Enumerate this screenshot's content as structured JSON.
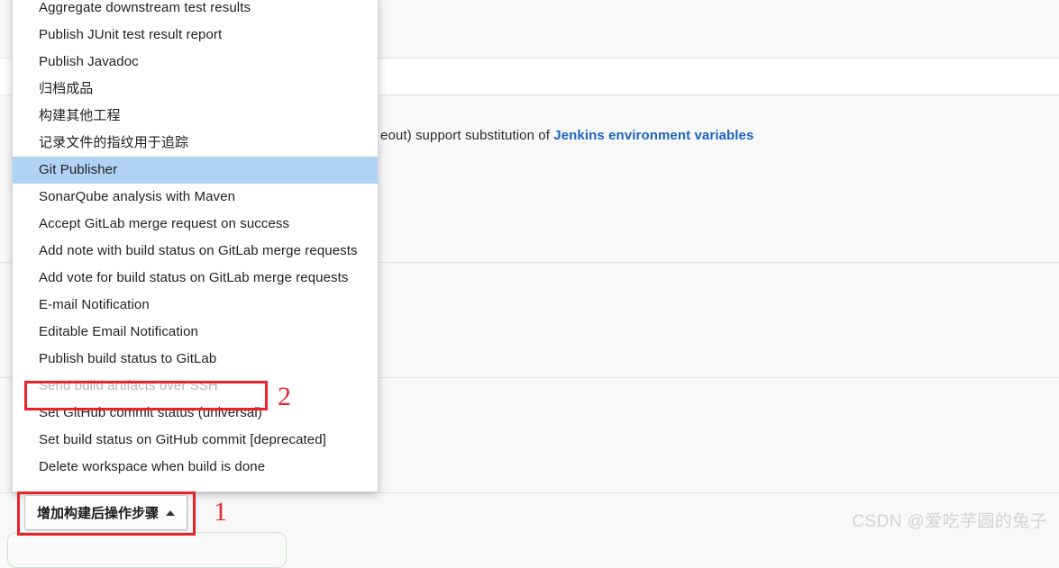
{
  "background": {
    "help_text_prefix": "eout) support substitution of ",
    "help_link_label": "Jenkins environment variables"
  },
  "dropdown": {
    "name": "post-build-actions-dropdown",
    "items": [
      {
        "label": "Aggregate downstream test results",
        "state": "normal"
      },
      {
        "label": "Publish JUnit test result report",
        "state": "normal"
      },
      {
        "label": "Publish Javadoc",
        "state": "normal"
      },
      {
        "label": "归档成品",
        "state": "normal"
      },
      {
        "label": "构建其他工程",
        "state": "normal"
      },
      {
        "label": "记录文件的指纹用于追踪",
        "state": "normal"
      },
      {
        "label": "Git Publisher",
        "state": "selected"
      },
      {
        "label": "SonarQube analysis with Maven",
        "state": "normal"
      },
      {
        "label": "Accept GitLab merge request on success",
        "state": "normal"
      },
      {
        "label": "Add note with build status on GitLab merge requests",
        "state": "normal"
      },
      {
        "label": "Add vote for build status on GitLab merge requests",
        "state": "normal"
      },
      {
        "label": "E-mail Notification",
        "state": "normal"
      },
      {
        "label": "Editable Email Notification",
        "state": "normal"
      },
      {
        "label": "Publish build status to GitLab",
        "state": "normal"
      },
      {
        "label": "Send build artifacts over SSH",
        "state": "disabled"
      },
      {
        "label": "Set GitHub commit status (universal)",
        "state": "normal"
      },
      {
        "label": "Set build status on GitHub commit [deprecated]",
        "state": "normal"
      },
      {
        "label": "Delete workspace when build is done",
        "state": "normal"
      }
    ]
  },
  "button": {
    "label": "增加构建后操作步骤"
  },
  "annotations": [
    {
      "number": "1",
      "target": "add-post-build-button"
    },
    {
      "number": "2",
      "target": "Send build artifacts over SSH"
    }
  ],
  "watermark": {
    "text": "CSDN @爱吃芋圆的兔子"
  },
  "colors": {
    "selection_highlight": "#b0d2f4",
    "annotation_red": "#e8232a",
    "link_blue": "#1f62c4",
    "disabled_text": "#b4b4b4"
  }
}
